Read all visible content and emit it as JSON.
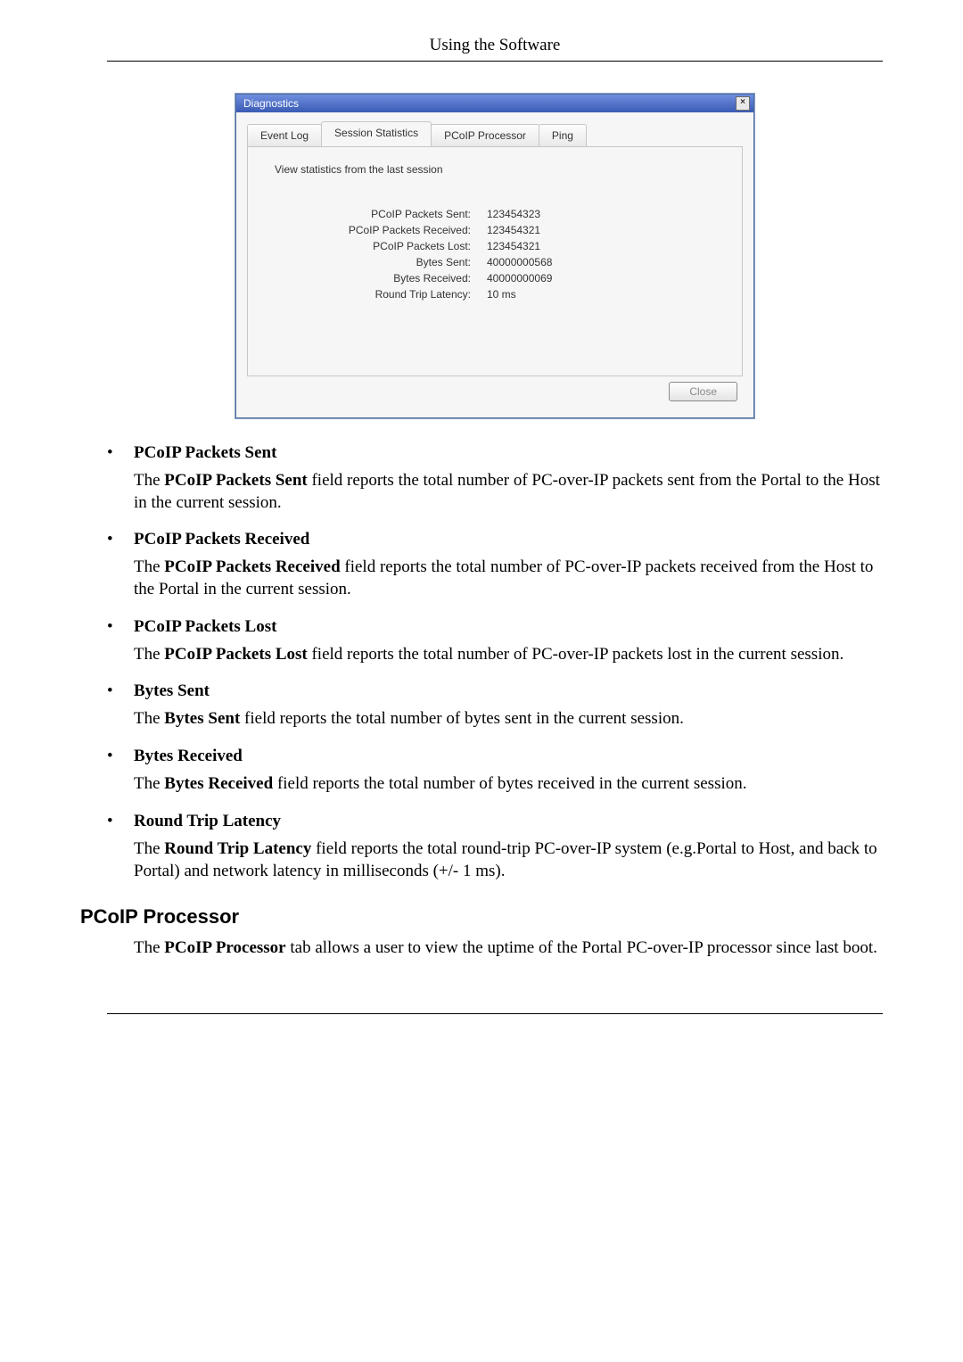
{
  "header": {
    "title": "Using the Software"
  },
  "figure": {
    "title": "Diagnostics",
    "close_symbol": "×",
    "tabs": [
      {
        "label": "Event Log"
      },
      {
        "label": "Session Statistics"
      },
      {
        "label": "PCoIP Processor"
      },
      {
        "label": "Ping"
      }
    ],
    "active_tab_index": 1,
    "description": "View statistics from the last session",
    "stats": [
      {
        "label": "PCoIP Packets Sent:",
        "value": "123454323"
      },
      {
        "label": "PCoIP Packets Received:",
        "value": "123454321"
      },
      {
        "label": "PCoIP Packets Lost:",
        "value": "123454321"
      },
      {
        "label": "Bytes Sent:",
        "value": "40000000568"
      },
      {
        "label": "Bytes Received:",
        "value": "40000000069"
      },
      {
        "label": "Round Trip Latency:",
        "value": "10 ms"
      }
    ],
    "close_button": "Close"
  },
  "bullets": [
    {
      "title": "PCoIP Packets Sent",
      "body_pre": "The ",
      "body_bold": "PCoIP Packets Sent",
      "body_post": " field reports the total number of PC-over-IP packets sent from the Portal to the Host in the current session."
    },
    {
      "title": "PCoIP Packets Received",
      "body_pre": "The ",
      "body_bold": "PCoIP Packets Received",
      "body_post": " field reports the total number of PC-over-IP packets received from the Host to the Portal in the current session."
    },
    {
      "title": "PCoIP Packets Lost",
      "body_pre": "The ",
      "body_bold": "PCoIP Packets Lost",
      "body_post": " field reports the total number of PC-over-IP packets lost in the current session."
    },
    {
      "title": "Bytes Sent",
      "body_pre": "The ",
      "body_bold": "Bytes Sent",
      "body_post": " field reports the total number of bytes sent in the current session."
    },
    {
      "title": "Bytes Received",
      "body_pre": "The ",
      "body_bold": "Bytes Received",
      "body_post": " field reports the total number of bytes received in the current session."
    },
    {
      "title": "Round Trip Latency",
      "body_pre": "The ",
      "body_bold": "Round Trip Latency",
      "body_post": " field reports the total round-trip PC-over-IP system (e.g.Portal to Host, and back to Portal) and network latency in milliseconds (+/- 1 ms)."
    }
  ],
  "section": {
    "title": "PCoIP Processor",
    "body_pre": "The ",
    "body_bold": "PCoIP Processor",
    "body_post": " tab allows a user to view the uptime of the Portal PC-over-IP processor since last boot."
  }
}
